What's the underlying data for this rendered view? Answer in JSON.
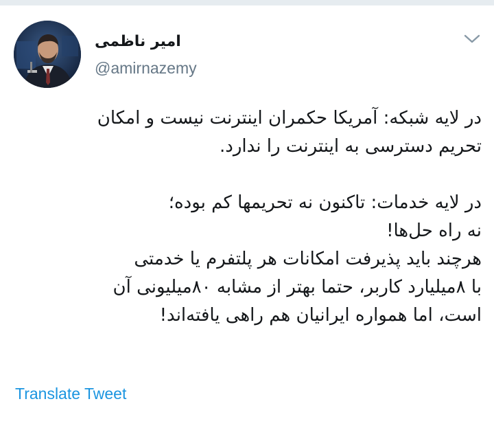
{
  "tweet": {
    "author": {
      "display_name": "امیر ناظمی",
      "handle": "@amirnazemy",
      "avatar_icon": "profile-photo"
    },
    "menu_icon": "chevron-down-icon",
    "paragraph_1": [
      "در لایه شبکه: آمریکا حکمران اینترنت نیست و امکان",
      "تحریم دسترسی به اینترنت را ندارد."
    ],
    "paragraph_2": [
      "در لایه خدمات: تاکنون نه تحریمها کم بوده؛",
      "نه راه حل‌ها!",
      "هرچند باید پذیرفت امکانات هر پلتفرم یا خدمتی",
      "با ۸میلیارد کاربر، حتما بهتر از مشابه ۸۰میلیونی آن",
      "است، اما همواره ایرانیان هم راهی یافته‌اند!"
    ],
    "translate_label": "Translate Tweet"
  },
  "colors": {
    "text": "#14171a",
    "secondary": "#657786",
    "link": "#1b95e0",
    "divider": "#e6ecf0"
  }
}
